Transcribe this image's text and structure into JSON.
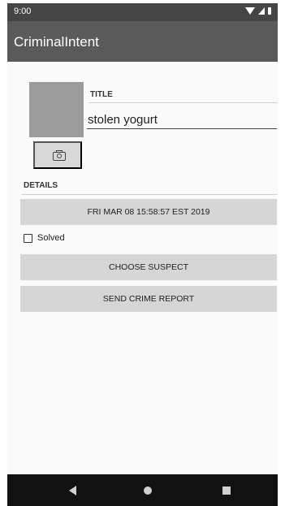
{
  "status_bar": {
    "time": "9:00"
  },
  "app_bar": {
    "title": "CriminalIntent"
  },
  "crime": {
    "title_label": "TITLE",
    "title_value": "stolen yogurt",
    "details_label": "DETAILS",
    "date_button": "FRI MAR 08 15:58:57 EST 2019",
    "solved_label": "Solved",
    "solved_checked": false,
    "suspect_button": "CHOOSE SUSPECT",
    "report_button": "SEND CRIME REPORT"
  },
  "icons": {
    "camera": "camera-icon",
    "nav_back": "back-icon",
    "nav_home": "home-icon",
    "nav_recent": "recent-apps-icon",
    "status": [
      "wifi-icon",
      "signal-icon",
      "battery-icon"
    ]
  },
  "colors": {
    "status_bar": "#454545",
    "app_bar": "#5a5a5a",
    "photo_placeholder": "#9b9b9b",
    "button_bg": "#d6d6d6",
    "nav_bar": "#111111"
  }
}
